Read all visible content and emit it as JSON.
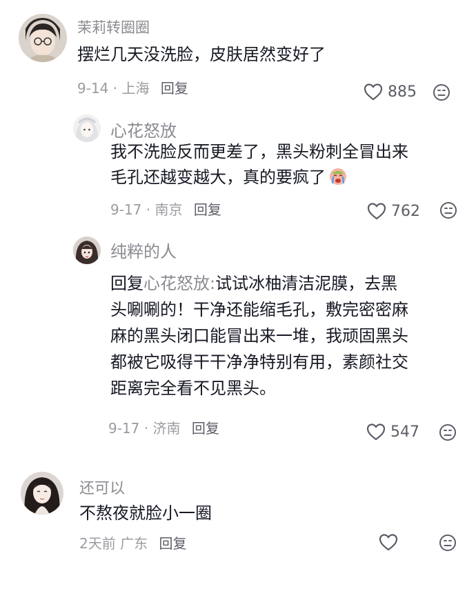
{
  "comments": [
    {
      "username": "茉莉转圈圈",
      "content_lines": [
        "摆烂几天没洗脸，皮肤居然变好了"
      ],
      "meta": "9-14 · 上海",
      "reply_label": "回复",
      "likes": "885"
    },
    {
      "username": "心花怒放",
      "content_lines": [
        "我不洗脸反而更差了，黑头粉刺全冒出来",
        "毛孔还越变越大，真的要疯了"
      ],
      "emoji": "crying-face-emoji",
      "meta": "9-17 · 南京",
      "reply_label": "回复",
      "likes": "762"
    },
    {
      "username": "纯粹的人",
      "reply_prefix": "回复",
      "mention": "心花怒放:",
      "first_line_rest": "试试冰柚清洁泥膜，去黑",
      "content_lines": [
        "头唰唰的！干净还能缩毛孔，敷完密密麻",
        "麻的黑头闭口能冒出来一堆，我顽固黑头",
        "都被它吸得干干净净特别有用，素颜社交",
        "距离完全看不见黑头。"
      ],
      "meta": "9-17 · 济南",
      "reply_label": "回复",
      "likes": "547"
    },
    {
      "username": "还可以",
      "content_lines": [
        "不熬夜就脸小一圈"
      ],
      "meta": "2天前 广东",
      "reply_label": "回复",
      "likes": ""
    }
  ],
  "icons": {
    "like": "heart-outline-icon",
    "dislike": "unhappy-face-icon"
  },
  "colors": {
    "text": "#161823",
    "muted": "#8a8b91",
    "reply": "#5b5d66"
  }
}
